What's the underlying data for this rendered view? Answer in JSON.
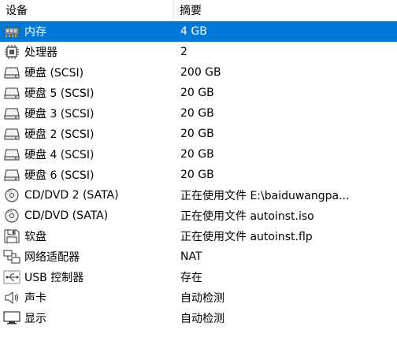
{
  "header": {
    "device": "设备",
    "summary": "摘要"
  },
  "rows": [
    {
      "icon": "memory-icon",
      "device": "内存",
      "summary": "4 GB",
      "selected": true
    },
    {
      "icon": "cpu-icon",
      "device": "处理器",
      "summary": "2"
    },
    {
      "icon": "disk-icon",
      "device": "硬盘 (SCSI)",
      "summary": "200 GB"
    },
    {
      "icon": "disk-icon",
      "device": "硬盘 5 (SCSI)",
      "summary": "20 GB"
    },
    {
      "icon": "disk-icon",
      "device": "硬盘 3 (SCSI)",
      "summary": "20 GB"
    },
    {
      "icon": "disk-icon",
      "device": "硬盘 2 (SCSI)",
      "summary": "20 GB"
    },
    {
      "icon": "disk-icon",
      "device": "硬盘 4 (SCSI)",
      "summary": "20 GB"
    },
    {
      "icon": "disk-icon",
      "device": "硬盘 6 (SCSI)",
      "summary": "20 GB"
    },
    {
      "icon": "cd-dvd-icon",
      "device": "CD/DVD 2 (SATA)",
      "summary": "正在使用文件 E:\\baiduwangpa..."
    },
    {
      "icon": "cd-dvd-icon",
      "device": "CD/DVD (SATA)",
      "summary": "正在使用文件 autoinst.iso"
    },
    {
      "icon": "floppy-icon",
      "device": "软盘",
      "summary": "正在使用文件 autoinst.flp"
    },
    {
      "icon": "network-adapter-icon",
      "device": "网络适配器",
      "summary": "NAT"
    },
    {
      "icon": "usb-icon",
      "device": "USB 控制器",
      "summary": "存在"
    },
    {
      "icon": "sound-card-icon",
      "device": "声卡",
      "summary": "自动检测"
    },
    {
      "icon": "display-icon",
      "device": "显示",
      "summary": "自动检测"
    }
  ],
  "colors": {
    "selection": "#0078d7"
  }
}
